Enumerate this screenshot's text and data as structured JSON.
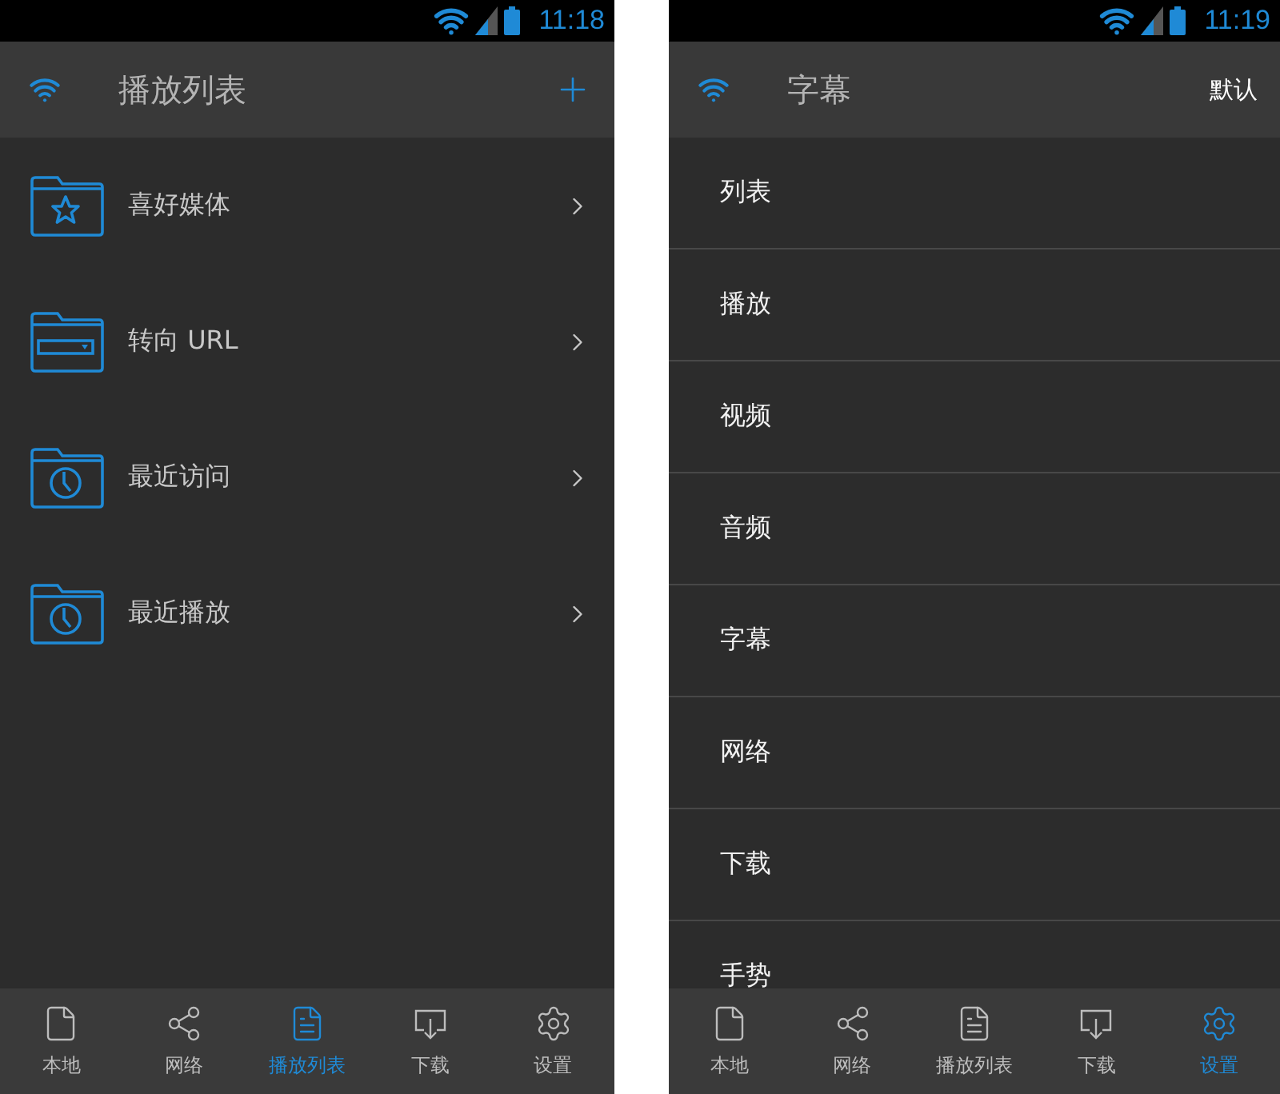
{
  "screens": [
    {
      "kind": "playlist",
      "status_time": "11:18",
      "header": {
        "title": "播放列表",
        "action": {
          "kind": "add"
        }
      },
      "items": [
        {
          "label": "喜好媒体",
          "kind": "star"
        },
        {
          "label": "转向 URL",
          "kind": "url"
        },
        {
          "label": "最近访问",
          "kind": "clock"
        },
        {
          "label": "最近播放",
          "kind": "clock"
        }
      ],
      "nav": [
        {
          "label": "本地",
          "kind": "file",
          "selected": false
        },
        {
          "label": "网络",
          "kind": "share",
          "selected": false
        },
        {
          "label": "播放列表",
          "kind": "document",
          "selected": true
        },
        {
          "label": "下载",
          "kind": "download",
          "selected": false
        },
        {
          "label": "设置",
          "kind": "gear",
          "selected": false
        }
      ]
    },
    {
      "kind": "settings",
      "status_time": "11:19",
      "header": {
        "title": "字幕",
        "action": {
          "kind": "text",
          "label": "默认"
        }
      },
      "items": [
        {
          "label": "列表"
        },
        {
          "label": "播放"
        },
        {
          "label": "视频"
        },
        {
          "label": "音频"
        },
        {
          "label": "字幕"
        },
        {
          "label": "网络"
        },
        {
          "label": "下载"
        },
        {
          "label": "手势"
        }
      ],
      "nav": [
        {
          "label": "本地",
          "kind": "file",
          "selected": false
        },
        {
          "label": "网络",
          "kind": "share",
          "selected": false
        },
        {
          "label": "播放列表",
          "kind": "document",
          "selected": false
        },
        {
          "label": "下载",
          "kind": "download",
          "selected": false
        },
        {
          "label": "设置",
          "kind": "gear",
          "selected": true
        }
      ]
    }
  ]
}
